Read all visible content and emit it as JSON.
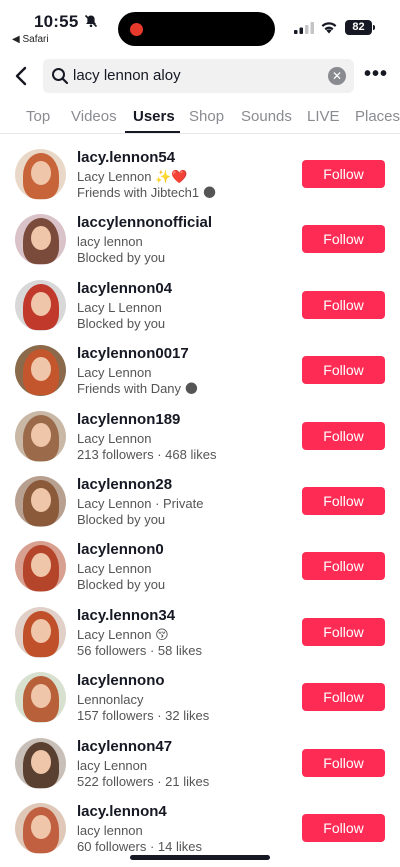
{
  "status_bar": {
    "time": "10:55",
    "back_app": "◀ Safari",
    "battery": "82"
  },
  "search": {
    "query": "lacy lennon aloy",
    "clear_glyph": "✕",
    "more_glyph": "•••"
  },
  "tabs": [
    {
      "label": "Top"
    },
    {
      "label": "Videos"
    },
    {
      "label": "Users"
    },
    {
      "label": "Shop"
    },
    {
      "label": "Sounds"
    },
    {
      "label": "LIVE"
    },
    {
      "label": "Places"
    }
  ],
  "active_tab": "Users",
  "colors": {
    "accent": "#fe2c55",
    "record_dot": "#e83a2c"
  },
  "users": [
    {
      "username": "lacy.lennon54",
      "display_name": "Lacy Lennon ✨❤️",
      "meta": "Friends with Jibtech1 🌑",
      "follow_label": "Follow",
      "hair": "#c8643a",
      "bg": "#e9d8c8"
    },
    {
      "username": "laccylennonofficial",
      "display_name": "lacy lennon",
      "meta": "Blocked by you",
      "follow_label": "Follow",
      "hair": "#7a4a3a",
      "bg": "#d9c2c8"
    },
    {
      "username": "lacylennon04",
      "display_name": "Lacy L Lennon",
      "meta": "Blocked by you",
      "follow_label": "Follow",
      "hair": "#c0392b",
      "bg": "#d8d8d8"
    },
    {
      "username": "lacylennon0017",
      "display_name": "Lacy Lennon",
      "meta": "Friends with Dany 🌑",
      "follow_label": "Follow",
      "hair": "#c4562e",
      "bg": "#8a6a4a"
    },
    {
      "username": "lacylennon189",
      "display_name": "Lacy Lennon",
      "meta": "213 followers · 468 likes",
      "follow_label": "Follow",
      "hair": "#9a6a4a",
      "bg": "#c9b8a6"
    },
    {
      "username": "lacylennon28",
      "display_name": "Lacy Lennon · Private",
      "meta": "Blocked by you",
      "follow_label": "Follow",
      "hair": "#8a5a3a",
      "bg": "#b8a090"
    },
    {
      "username": "lacylennon0",
      "display_name": "Lacy Lennon",
      "meta": "Blocked by you",
      "follow_label": "Follow",
      "hair": "#b5452a",
      "bg": "#d8a090"
    },
    {
      "username": "lacy.lennon34",
      "display_name": "Lacy Lennon 😚",
      "meta": "56 followers · 58 likes",
      "follow_label": "Follow",
      "hair": "#c0502a",
      "bg": "#e0d0c8"
    },
    {
      "username": "lacylennono",
      "display_name": "Lennonlacy",
      "meta": "157 followers · 32 likes",
      "follow_label": "Follow",
      "hair": "#b8603a",
      "bg": "#d8e0d0"
    },
    {
      "username": "lacylennon47",
      "display_name": "lacy Lennon",
      "meta": "522 followers · 21 likes",
      "follow_label": "Follow",
      "hair": "#5a4030",
      "bg": "#c8c0b8"
    },
    {
      "username": "lacy.lennon4",
      "display_name": "lacy lennon",
      "meta": "60 followers · 14 likes",
      "follow_label": "Follow",
      "hair": "#c06040",
      "bg": "#e0c8b8"
    }
  ]
}
